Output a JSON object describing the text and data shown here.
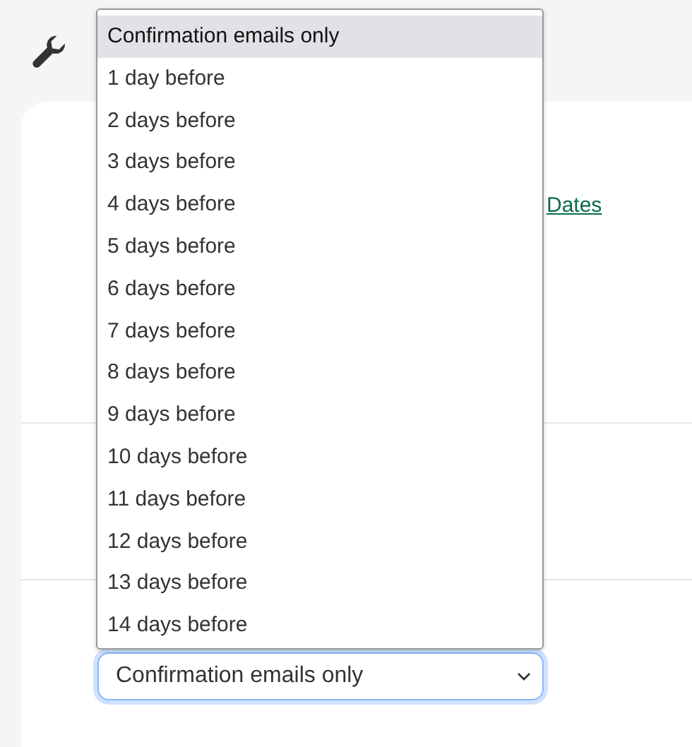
{
  "link": {
    "text": "Dates"
  },
  "reminder_select": {
    "value": "Confirmation emails only"
  },
  "dropdown": {
    "options": [
      {
        "label": "Confirmation emails only",
        "selected": true
      },
      {
        "label": "1 day before",
        "selected": false
      },
      {
        "label": "2 days before",
        "selected": false
      },
      {
        "label": "3 days before",
        "selected": false
      },
      {
        "label": "4 days before",
        "selected": false
      },
      {
        "label": "5 days before",
        "selected": false
      },
      {
        "label": "6 days before",
        "selected": false
      },
      {
        "label": "7 days before",
        "selected": false
      },
      {
        "label": "8 days before",
        "selected": false
      },
      {
        "label": "9 days before",
        "selected": false
      },
      {
        "label": "10 days before",
        "selected": false
      },
      {
        "label": "11 days before",
        "selected": false
      },
      {
        "label": "12 days before",
        "selected": false
      },
      {
        "label": "13 days before",
        "selected": false
      },
      {
        "label": "14 days before",
        "selected": false
      }
    ]
  }
}
